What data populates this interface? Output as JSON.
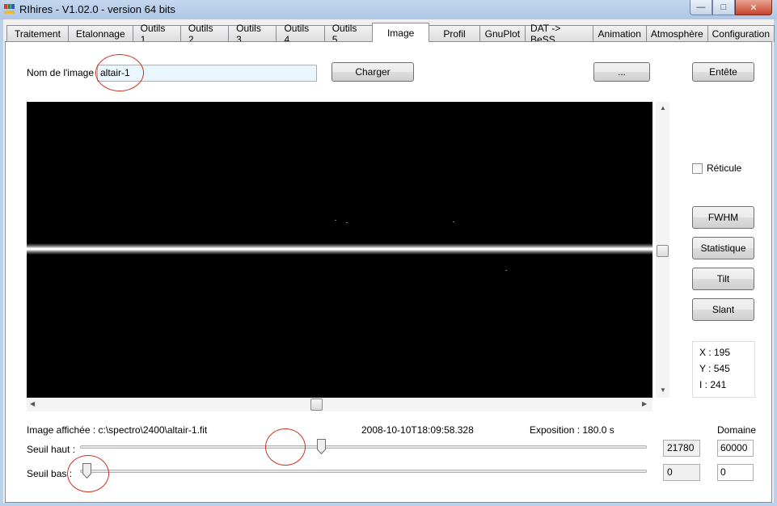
{
  "window": {
    "title": "RIhires - V1.02.0 - version 64 bits",
    "controls": [
      "minimize",
      "maximize",
      "close"
    ]
  },
  "tabs": [
    {
      "label": "Traitement"
    },
    {
      "label": "Etalonnage"
    },
    {
      "label": "Outils 1"
    },
    {
      "label": "Outils 2"
    },
    {
      "label": "Outils 3"
    },
    {
      "label": "Outils 4"
    },
    {
      "label": "Outils 5"
    },
    {
      "label": "Image",
      "active": true
    },
    {
      "label": "Profil"
    },
    {
      "label": "GnuPlot"
    },
    {
      "label": "DAT -> BeSS"
    },
    {
      "label": "Animation"
    },
    {
      "label": "Atmosphère"
    },
    {
      "label": "Configuration"
    }
  ],
  "image_panel": {
    "name_label": "Nom de l'image :",
    "name_value": "altair-1",
    "load_button": "Charger",
    "browse_button": "...",
    "header_button": "Entête",
    "reticle_label": "Réticule",
    "reticle_checked": false,
    "buttons": {
      "fwhm": "FWHM",
      "stats": "Statistique",
      "tilt": "Tilt",
      "slant": "Slant"
    },
    "cursor": {
      "x": "X : 195",
      "y": "Y : 545",
      "i": "I : 241"
    },
    "displayed_label": "Image affichée : c:\\spectro\\2400\\altair-1.fit",
    "timestamp": "2008-10-10T18:09:58.328",
    "exposure": "Exposition : 180.0 s",
    "domain_label": "Domaine",
    "high_label": "Seuil haut :",
    "high_value": "21780",
    "high_domain": "60000",
    "high_fraction": 0.42,
    "low_label": "Seuil bas :",
    "low_value": "0",
    "low_domain": "0",
    "low_fraction": 0.0
  },
  "colors": {
    "annotation": "#c8321e",
    "page_bg": "#f0f0f0",
    "titlebar": "#b9d1ea"
  }
}
